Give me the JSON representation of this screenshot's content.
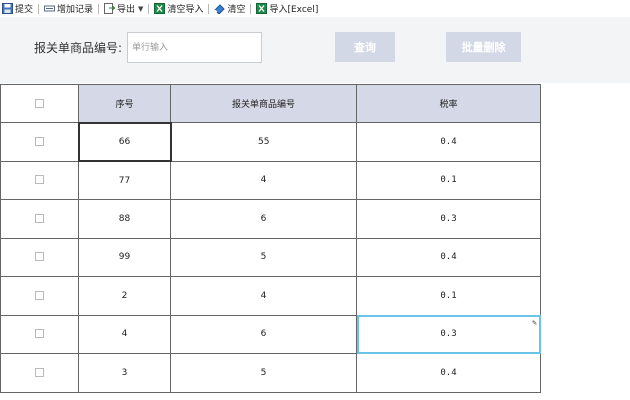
{
  "toolbar": {
    "items": [
      {
        "label": "提交",
        "icon": "save-icon"
      },
      {
        "label": "增加记录",
        "icon": "add-record-icon"
      },
      {
        "label": "导出",
        "icon": "export-icon",
        "dropdown": true
      },
      {
        "label": "清空导入",
        "icon": "excel-icon"
      },
      {
        "label": "清空",
        "icon": "eraser-icon"
      },
      {
        "label": "导入[Excel]",
        "icon": "excel-icon"
      }
    ]
  },
  "search": {
    "label": "报关单商品编号:",
    "placeholder": "单行输入",
    "value": "",
    "query_label": "查询",
    "delete_label": "批量删除"
  },
  "table": {
    "headers": [
      "序号",
      "报关单商品编号",
      "税率"
    ],
    "rows": [
      {
        "seq": "66",
        "code": "55",
        "rate": "0.4"
      },
      {
        "seq": "77",
        "code": "4",
        "rate": "0.1"
      },
      {
        "seq": "88",
        "code": "6",
        "rate": "0.3"
      },
      {
        "seq": "99",
        "code": "5",
        "rate": "0.4"
      },
      {
        "seq": "2",
        "code": "4",
        "rate": "0.1"
      },
      {
        "seq": "4",
        "code": "6",
        "rate": "0.3"
      },
      {
        "seq": "3",
        "code": "5",
        "rate": "0.4"
      }
    ]
  },
  "colors": {
    "header_bg": "#d5d9e7",
    "button_bg": "#d2d8e6",
    "panel_bg": "#f3f4f6",
    "edit_highlight": "#6cc3e8"
  }
}
